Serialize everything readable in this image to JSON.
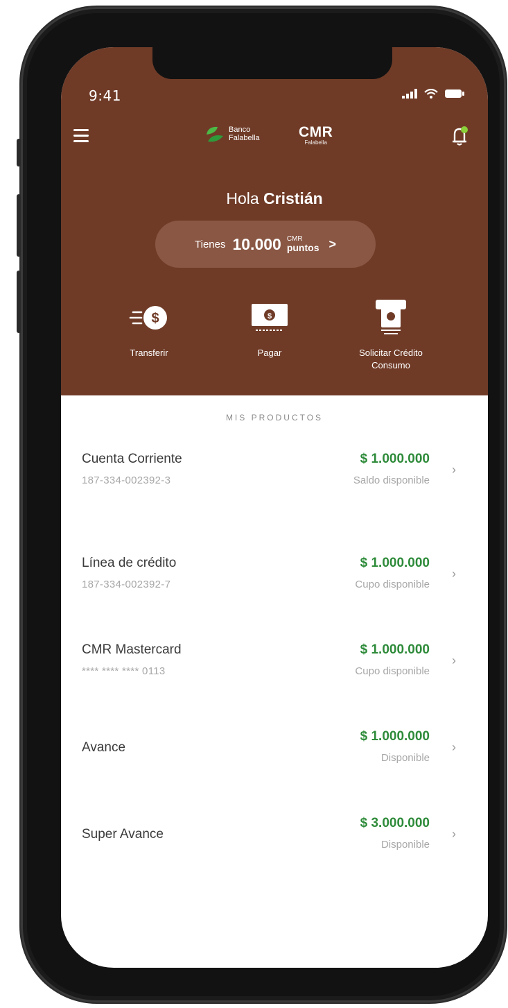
{
  "status_bar": {
    "time": "9:41"
  },
  "header": {
    "brand_bank_line1": "Banco",
    "brand_bank_line2": "Falabella",
    "brand_cmr": "CMR",
    "brand_cmr_sub": "Falabella",
    "greeting_prefix": "Hola",
    "greeting_name": "Cristián"
  },
  "points": {
    "label": "Tienes",
    "value": "10.000",
    "unit_top": "CMR",
    "unit_bottom": "puntos",
    "chevron": ">"
  },
  "actions": [
    {
      "label": "Transferir",
      "icon": "transfer-money-icon"
    },
    {
      "label": "Pagar",
      "icon": "pay-bill-icon"
    },
    {
      "label": "Solicitar Crédito Consumo",
      "icon": "atm-credit-icon"
    }
  ],
  "products_title": "MIS PRODUCTOS",
  "products": [
    {
      "name": "Cuenta Corriente",
      "number": "187-334-002392-3",
      "amount": "$ 1.000.000",
      "sub": "Saldo disponible"
    },
    {
      "name": "Línea de crédito",
      "number": "187-334-002392-7",
      "amount": "$ 1.000.000",
      "sub": "Cupo disponible"
    },
    {
      "name": "CMR Mastercard",
      "number": "**** **** **** 0113",
      "amount": "$ 1.000.000",
      "sub": "Cupo disponible"
    },
    {
      "name": "Avance",
      "number": "",
      "amount": "$ 1.000.000",
      "sub": "Disponible"
    },
    {
      "name": "Super Avance",
      "number": "",
      "amount": "$ 3.000.000",
      "sub": "Disponible"
    }
  ],
  "colors": {
    "header_bg": "#6f3b27",
    "points_pill_bg": "#8a5744",
    "amount_green": "#2e8b3a",
    "bell_badge": "#8bd13a",
    "bank_logo_green": "#4cb846"
  }
}
